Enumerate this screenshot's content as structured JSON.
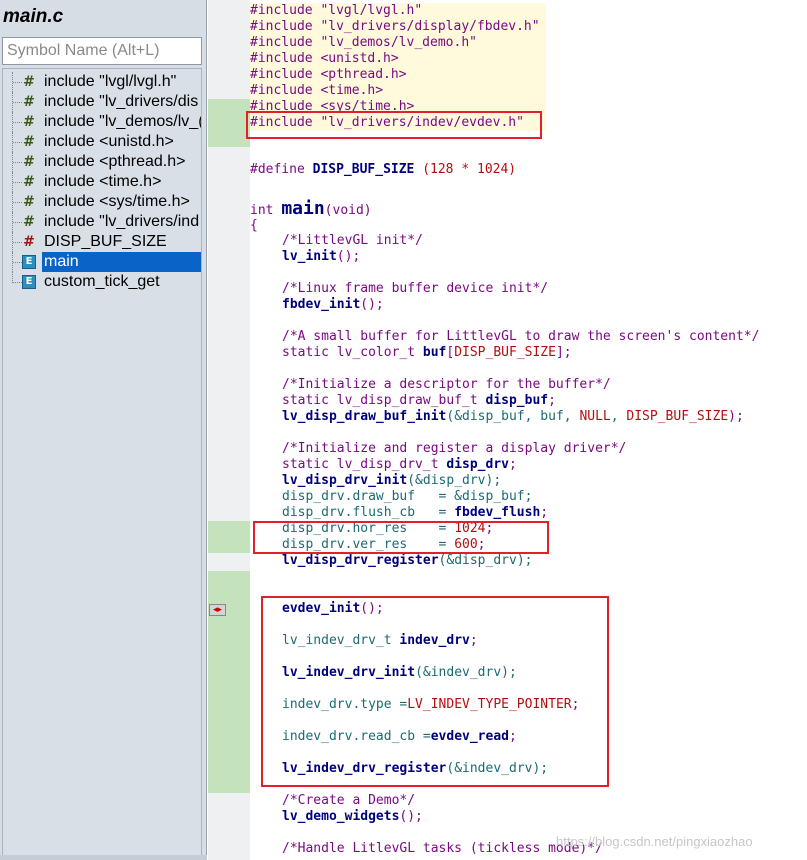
{
  "sidebar": {
    "file_title": "main.c",
    "search_placeholder": "Symbol Name (Alt+L)",
    "items": [
      {
        "label": "include \"lvgl/lvgl.h\"",
        "icon": "include-icon"
      },
      {
        "label": "include \"lv_drivers/dis",
        "icon": "include-icon"
      },
      {
        "label": "include \"lv_demos/lv_(",
        "icon": "include-icon"
      },
      {
        "label": "include <unistd.h>",
        "icon": "include-icon"
      },
      {
        "label": "include <pthread.h>",
        "icon": "include-icon"
      },
      {
        "label": "include <time.h>",
        "icon": "include-icon"
      },
      {
        "label": "include <sys/time.h>",
        "icon": "include-icon"
      },
      {
        "label": "include \"lv_drivers/ind",
        "icon": "include-icon"
      },
      {
        "label": "DISP_BUF_SIZE",
        "icon": "define-icon"
      },
      {
        "label": "main",
        "icon": "function-icon",
        "selected": true
      },
      {
        "label": "custom_tick_get",
        "icon": "function-icon"
      }
    ]
  },
  "code": {
    "inc1": "#include \"lvgl/lvgl.h\"",
    "inc2": "#include \"lv_drivers/display/fbdev.h\"",
    "inc3": "#include \"lv_demos/lv_demo.h\"",
    "inc4": "#include <unistd.h>",
    "inc5": "#include <pthread.h>",
    "inc6": "#include <time.h>",
    "inc7": "#include <sys/time.h>",
    "inc8": "#include \"lv_drivers/indev/evdev.h\"",
    "define_kw": "#define ",
    "define_name": "DISP_BUF_SIZE",
    "define_val": " (128 * 1024)",
    "int_kw": "int ",
    "main_name": "main",
    "main_args": "(void)",
    "brace_open": "{",
    "c_init": "/*LittlevGL init*/",
    "lv_init": "lv_init",
    "paren_semi": "();",
    "c_fb": "/*Linux frame buffer device init*/",
    "fbdev_init": "fbdev_init",
    "c_buf": "/*A small buffer for LittlevGL to draw the screen's content*/",
    "buf_decl_a": "static lv_color_t ",
    "buf_name": "buf",
    "buf_decl_b": "[",
    "buf_size": "DISP_BUF_SIZE",
    "buf_decl_c": "];",
    "c_desc": "/*Initialize a descriptor for the buffer*/",
    "draw_buf_decl": "static lv_disp_draw_buf_t ",
    "disp_buf_name": "disp_buf",
    "semi": ";",
    "draw_buf_init": "lv_disp_draw_buf_init",
    "draw_buf_args_a": "(&disp_buf, buf, ",
    "null_kw": "NULL",
    "comma": ", ",
    "draw_buf_args_b": ");",
    "c_reg": "/*Initialize and register a display driver*/",
    "drv_decl": "static lv_disp_drv_t ",
    "disp_drv_name": "disp_drv",
    "drv_init": "lv_disp_drv_init",
    "drv_init_args": "(&disp_drv);",
    "draw_buf_assign": "disp_drv.draw_buf   = &disp_buf;",
    "flush_assign_a": "disp_drv.flush_cb   = ",
    "flush_fn": "fbdev_flush",
    "hor_a": "disp_drv.hor_res    = ",
    "hor_val": "1024",
    "ver_a": "disp_drv.ver_res    = ",
    "ver_val": "600",
    "drv_register": "lv_disp_drv_register",
    "drv_register_args": "(&disp_drv);",
    "evdev_init": "evdev_init",
    "indev_decl": "lv_indev_drv_t ",
    "indev_drv_name": "indev_drv",
    "indev_init": "lv_indev_drv_init",
    "indev_init_args": "(&indev_drv);",
    "type_a": "indev_drv.type =",
    "type_val": "LV_INDEV_TYPE_POINTER",
    "read_a": "indev_drv.read_cb =",
    "read_fn": "evdev_read",
    "indev_register": "lv_indev_drv_register",
    "indev_register_args": "(&indev_drv);",
    "c_demo": "/*Create a Demo*/",
    "demo_fn": "lv_demo_widgets",
    "c_tasks": "/*Handle LitlevGL tasks (tickless mode)*/"
  },
  "watermark": "https://blog.csdn.net/pingxiaozhao",
  "colors": {
    "selection": "#0a64c8",
    "highlight_box": "#e0202a",
    "diff_gutter": "#c4e3bc",
    "include_bg": "#fefadb"
  }
}
